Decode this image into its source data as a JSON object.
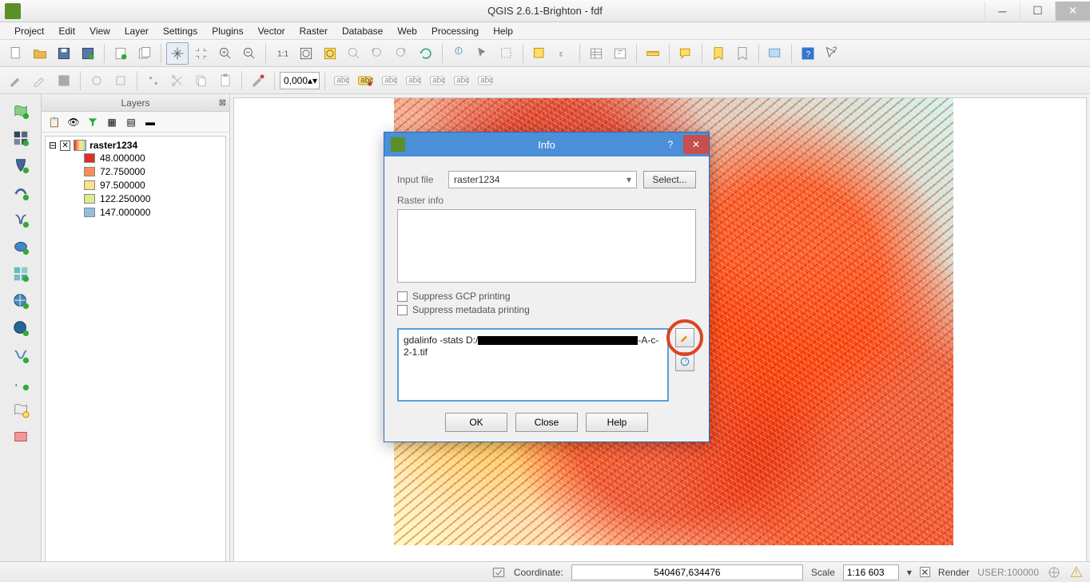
{
  "titlebar": {
    "title": "QGIS 2.6.1-Brighton - fdf"
  },
  "menu": [
    "Project",
    "Edit",
    "View",
    "Layer",
    "Settings",
    "Plugins",
    "Vector",
    "Raster",
    "Database",
    "Web",
    "Processing",
    "Help"
  ],
  "toolbar2_spin": "0,000",
  "layers_panel": {
    "title": "Layers",
    "layer_name": "raster1234",
    "legend": [
      {
        "color": "#d73027",
        "label": "48.000000"
      },
      {
        "color": "#fc8d59",
        "label": "72.750000"
      },
      {
        "color": "#fee08b",
        "label": "97.500000"
      },
      {
        "color": "#d9ef8b",
        "label": "122.250000"
      },
      {
        "color": "#91bfdb",
        "label": "147.000000"
      }
    ]
  },
  "dialog": {
    "title": "Info",
    "input_file_label": "Input file",
    "input_file_value": "raster1234",
    "select_btn": "Select...",
    "raster_info_label": "Raster info",
    "suppress_gcp": "Suppress GCP printing",
    "suppress_meta": "Suppress metadata printing",
    "cmd_prefix": "gdalinfo -stats D:/",
    "cmd_suffix": "-A-c-2-1.tif",
    "ok": "OK",
    "close": "Close",
    "help": "Help"
  },
  "statusbar": {
    "coord_label": "Coordinate:",
    "coord_value": "540467,634476",
    "scale_label": "Scale",
    "scale_value": "1:16 603",
    "render_label": "Render",
    "user_label": "USER:100000"
  }
}
